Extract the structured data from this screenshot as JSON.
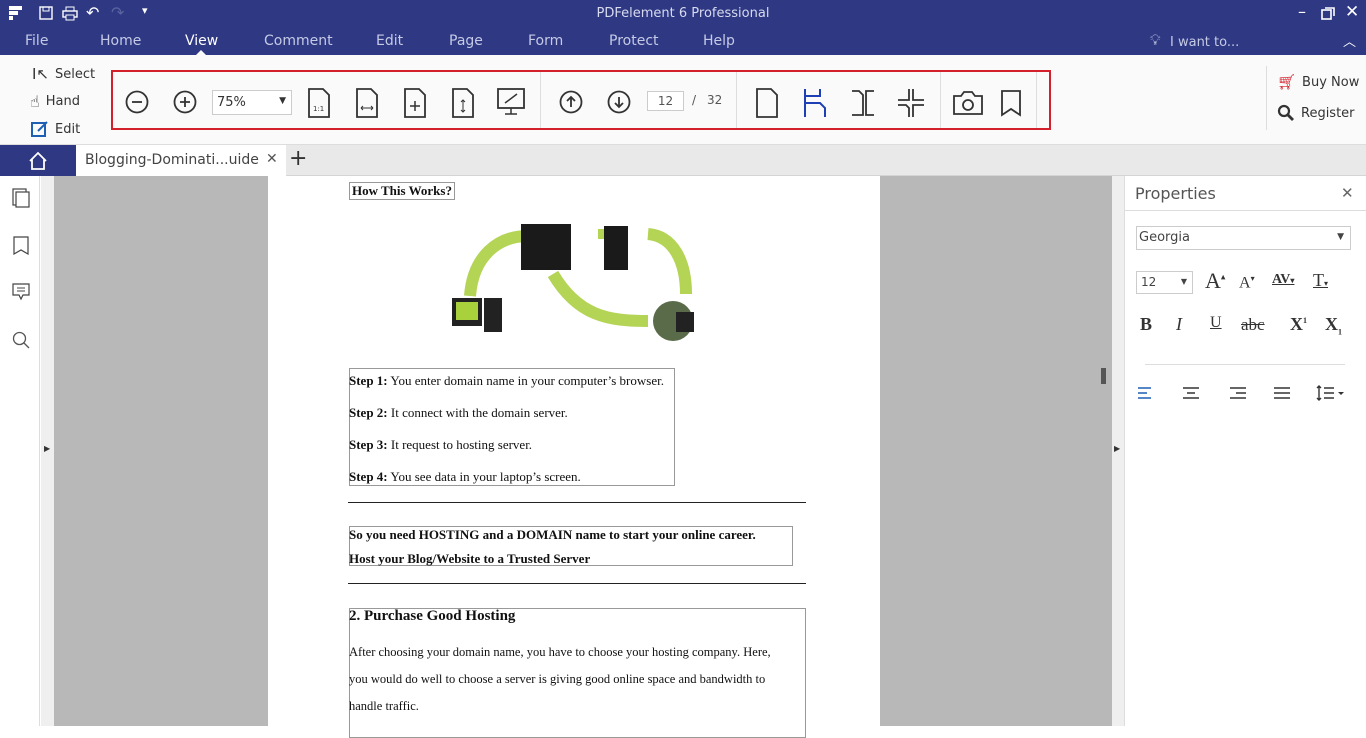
{
  "app": {
    "title": "PDFelement 6 Professional"
  },
  "menu": {
    "items": [
      "File",
      "Home",
      "View",
      "Comment",
      "Edit",
      "Page",
      "Form",
      "Protect",
      "Help"
    ],
    "active": "View",
    "i_want_to": "I want to..."
  },
  "ribbon": {
    "select": "Select",
    "hand": "Hand",
    "edit": "Edit",
    "zoom": "75%",
    "page_current": "12",
    "page_separator": "/",
    "page_total": "32",
    "buy_now": "Buy Now",
    "register": "Register",
    "highlight_color": "#d4202c"
  },
  "tabs": {
    "doc": "Blogging-Dominati...uide"
  },
  "document": {
    "heading1": "How This Works?",
    "steps": [
      {
        "label": "Step 1:",
        "text": " You enter domain name in your computer’s browser."
      },
      {
        "label": "Step 2:",
        "text": " It connect with the domain server."
      },
      {
        "label": "Step 3:",
        "text": " It request to hosting server."
      },
      {
        "label": "Step 4:",
        "text": " You see data in your laptop’s screen."
      }
    ],
    "callout1": "So you need HOSTING and a DOMAIN name to start your online career.",
    "callout2": "Host your Blog/Website to a Trusted Server",
    "heading2": "2. Purchase Good Hosting",
    "para": [
      "After choosing your domain name, you have to choose your hosting company. Here,",
      "you would do well to choose a server is giving good online space and bandwidth to",
      "handle traffic."
    ]
  },
  "properties": {
    "title": "Properties",
    "font": "Georgia",
    "size": "12"
  },
  "colors": {
    "brand": "#2e3883",
    "accent": "#1f5fb4"
  }
}
